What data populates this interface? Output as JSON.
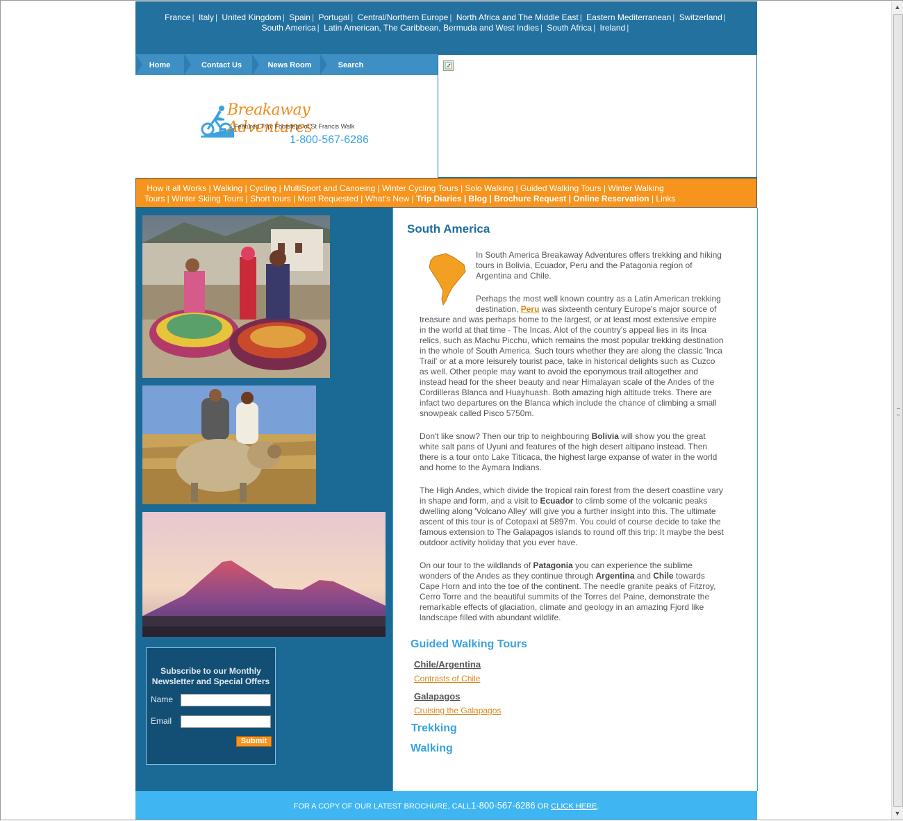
{
  "countries": {
    "row1": [
      "France",
      "Italy",
      "United Kingdom",
      "Spain",
      "Portugal",
      "Central/Northern Europe",
      "North Africa and The Middle East",
      "Eastern Mediterranean",
      "Switzerland"
    ],
    "row2": [
      "South America",
      "Latin American, The Caribbean, Bermuda and West Indies",
      "South Africa",
      "Ireland"
    ]
  },
  "topnav": [
    "Home",
    "Contact Us",
    "News Room",
    "Search"
  ],
  "logo": {
    "name": "Breakaway Adventures",
    "featured": "Featured Trip: Footsteps of St Francis Walk",
    "phone": "1-800-567-6286"
  },
  "activities": {
    "line1": "How it all Works | Walking | Cycling | MultiSport and Canoeing | Winter Cycling Tours | Solo Walking | Guided Walking Tours | Winter Walking",
    "line2_normal": "Tours | Winter Skiing Tours | Short tours | Most Requested | What's New | ",
    "line2_bold": "Trip Diaries | Blog | Brochure Request | Online Reservation",
    "line2_end": " | Links"
  },
  "main": {
    "title": "South America",
    "p1": "In South America Breakaway Adventures offers trekking and hiking tours in Bolivia, Ecuador, Peru and the Patagonia region of Argentina and Chile.",
    "p2_a": "Perhaps the  most well known country as a Latin American trekking destination, ",
    "p2_link": "Peru",
    "p2_b": " was sixteenth century Europe's major source of treasure and was perhaps home to the largest, or at least most extensive empire in the world at that time - The Incas. Alot of the country's appeal lies in its Inca relics, such as  Machu Picchu, which remains the most popular trekking destination in the whole of South America. Such tours whether they are along the classic 'Inca Trail' or at a more leisurely tourist pace, take in historical delights such as Cuzco as well. Other people may want to avoid the eponymous trail altogether and instead head for the sheer beauty and near Himalayan scale of the Andes of the Cordilleras Blanca and Huayhuash. Both amazing high altitude treks. There are infact two departures on the Blanca which include the chance of climbing a small snowpeak called Pisco 5750m.",
    "p3_a": "Don't like snow? Then our trip to neighbouring ",
    "p3_bold": "Bolivia",
    "p3_b": " will show you the great white salt pans of Uyuni and features of the high desert altipano  instead. Then there is a tour onto Lake Titicaca, the highest large expanse of water in the world and home to the Aymara Indians.",
    "p4_a": "The High Andes, which divide the tropical rain forest from the desert coastline vary in shape and form, and a visit to ",
    "p4_bold": "Ecuador",
    "p4_b": " to climb some of the volcanic peaks dwelling along 'Volcano Alley' will give you a further insight into this. The ultimate ascent  of this tour is of Cotopaxi at 5897m.  You could of course decide to take the famous extension to The Galapagos islands to round off this trip: It maybe the best outdoor activity holiday that you ever have.",
    "p5_a": "On our tour to the wildlands of ",
    "p5_bold1": "Patagonia",
    "p5_b": " you can experience the sublime wonders of the Andes as they continue through ",
    "p5_bold2": "Argentina",
    "p5_c": " and ",
    "p5_bold3": "Chile",
    "p5_d": " towards Cape Horn and into the toe of the continent. The needle granite peaks of  Fitzroy, Cerro Torre and the beautiful summits of the Torres del Paine,  demonstrate the remarkable effects of glaciation, climate and geology in an amazing Fjord like landscape  filled with abundant wildlife."
  },
  "tours": {
    "guided_heading": "Guided Walking Tours",
    "chile_heading": "Chile/Argentina",
    "chile_link": "Contrasts of Chile",
    "galapagos_heading": "Galapagos",
    "galapagos_link": "Cruising the Galapagos",
    "trekking_heading": "Trekking",
    "walking_heading": "Walking"
  },
  "subscribe": {
    "title": "Subscribe to our Monthly Newsletter and Special Offers",
    "name_label": "Name",
    "email_label": "Email",
    "submit": "Submit"
  },
  "footer": {
    "text": "FOR A COPY OF OUR LATEST BROCHURE, CALL",
    "phone": "1-800-567-6286",
    "or": " OR ",
    "click": "CLICK HERE",
    "end": "."
  },
  "colors": {
    "header_blue": "#22719f",
    "nav_blue": "#3e8fc4",
    "orange": "#f7941d",
    "footer_blue": "#3fb6f2",
    "link_orange": "#d8861c"
  }
}
